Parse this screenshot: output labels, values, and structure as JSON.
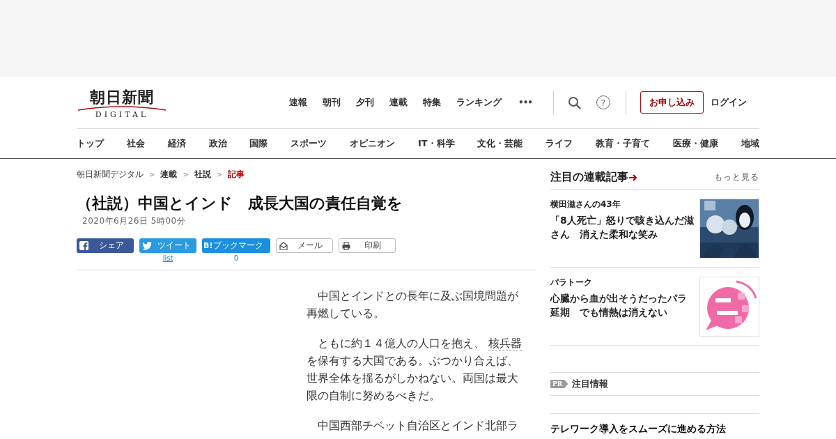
{
  "logo": {
    "name": "朝日新聞",
    "sub": "DIGITAL"
  },
  "top_nav": [
    "速報",
    "朝刊",
    "夕刊",
    "連載",
    "特集",
    "ランキング"
  ],
  "more_button": "•••",
  "help_button": "?",
  "subscribe_button": "お申し込み",
  "login_link": "ログイン",
  "categories": [
    "トップ",
    "社会",
    "経済",
    "政治",
    "国際",
    "スポーツ",
    "オピニオン",
    "IT・科学",
    "文化・芸能",
    "ライフ",
    "教育・子育て",
    "医療・健康",
    "地域"
  ],
  "breadcrumbs": [
    {
      "label": "朝日新聞デジタル",
      "selected": false
    },
    {
      "label": "連載",
      "selected": false
    },
    {
      "label": "社説",
      "selected": false
    },
    {
      "label": "記事",
      "selected": true
    }
  ],
  "breadcrumb_separator": ">",
  "article": {
    "title": "（社説）中国とインド　成長大国の責任自覚を",
    "date": "2020年6月26日 5時00分",
    "share_buttons": [
      {
        "kind": "facebook",
        "label": "シェア"
      },
      {
        "kind": "twitter",
        "label": "ツイート",
        "count": "list"
      },
      {
        "kind": "hatena",
        "badge": "B!",
        "label": "ブックマーク",
        "count": "0"
      },
      {
        "kind": "mail",
        "label": "メール"
      },
      {
        "kind": "print",
        "label": "印刷"
      }
    ],
    "paragraphs": [
      {
        "parts": [
          {
            "text": "　中国とインドとの長年に及ぶ国境問題が再燃している。",
            "link": false
          }
        ]
      },
      {
        "parts": [
          {
            "text": "　ともに約１４億人の人口を抱え、 ",
            "link": false
          },
          {
            "text": "核兵器",
            "link": true
          },
          {
            "text": " を保有する大国である。ぶつかり合えば、世界全体を揺るがしかねない。両国は最大限の自制に努めるべきだ。",
            "link": false
          }
        ]
      },
      {
        "parts": [
          {
            "text": "　中国西部チベット自治区とインド北部ラ",
            "link": false
          }
        ]
      }
    ]
  },
  "sidebar": {
    "title": "注目の連載記事",
    "more_link": "もっと見る",
    "items": [
      {
        "series": "横田滋さんの43年",
        "headline": "「8人死亡」怒りで咳き込んだ滋さん　消えた柔和な笑み"
      },
      {
        "series": "パラトーク",
        "headline": "心臓から血が出そうだったパラ延期　でも情熱は消えない",
        "kind": "logo"
      }
    ],
    "pr": {
      "badge": "PR",
      "title": "注目情報",
      "items": [
        {
          "headline": "テレワーク導入をスムーズに進める方法"
        }
      ]
    }
  }
}
